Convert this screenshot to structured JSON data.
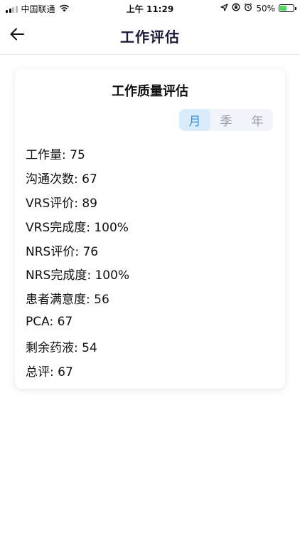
{
  "status_bar": {
    "carrier": "中国联通",
    "time": "上午 11:29",
    "battery_percent_text": "50%",
    "battery_level": 0.5,
    "icons": [
      "signal-icon",
      "wifi-icon",
      "location-icon",
      "rotation-lock-icon",
      "alarm-icon",
      "battery-charging-icon"
    ]
  },
  "nav": {
    "title": "工作评估",
    "back_icon": "back-arrow-icon"
  },
  "card": {
    "title": "工作质量评估",
    "period_options": [
      "月",
      "季",
      "年"
    ],
    "selected_period": "月",
    "metrics": [
      "工作量: 75",
      "沟通次数: 67",
      "VRS评价: 89",
      "VRS完成度: 100%",
      "NRS评价: 76",
      "NRS完成度: 100%",
      "患者满意度: 56",
      "PCA: 67",
      "剩余药液: 54",
      "总评: 67"
    ]
  },
  "colors": {
    "accent": "#3b8ee0",
    "accent_bg": "#d9ecfb",
    "toggle_bg": "#f1f4f8",
    "battery": "#4cd964",
    "title": "#1a1a3a"
  }
}
